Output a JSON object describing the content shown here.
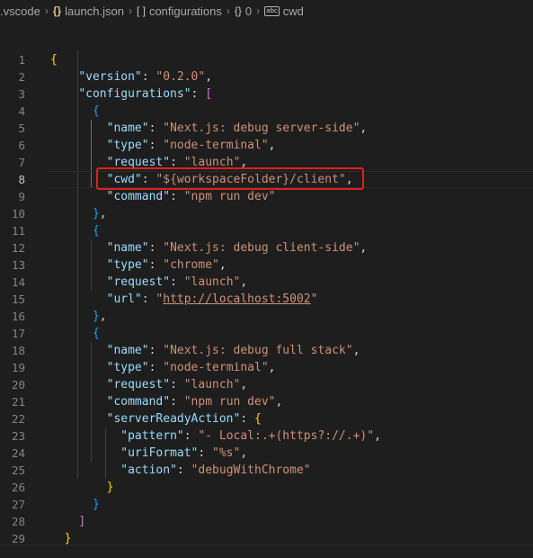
{
  "breadcrumb": {
    "folder": ".vscode",
    "file": "launch.json",
    "array": "configurations",
    "object": "0",
    "property": "cwd"
  },
  "editor": {
    "active_line": 8,
    "lines": [
      {
        "n": "1",
        "tokens": [
          [
            "b1",
            "{"
          ]
        ]
      },
      {
        "n": "2",
        "tokens": [
          [
            "p",
            "    "
          ],
          [
            "k",
            "\"version\""
          ],
          [
            "p",
            ": "
          ],
          [
            "s",
            "\"0.2.0\""
          ],
          [
            "p",
            ","
          ]
        ]
      },
      {
        "n": "3",
        "tokens": [
          [
            "p",
            "    "
          ],
          [
            "k",
            "\"configurations\""
          ],
          [
            "p",
            ": "
          ],
          [
            "b2",
            "["
          ]
        ]
      },
      {
        "n": "4",
        "tokens": [
          [
            "p",
            "      "
          ],
          [
            "b3",
            "{"
          ]
        ]
      },
      {
        "n": "5",
        "tokens": [
          [
            "p",
            "        "
          ],
          [
            "k",
            "\"name\""
          ],
          [
            "p",
            ": "
          ],
          [
            "s",
            "\"Next.js: debug server-side\""
          ],
          [
            "p",
            ","
          ]
        ]
      },
      {
        "n": "6",
        "tokens": [
          [
            "p",
            "        "
          ],
          [
            "k",
            "\"type\""
          ],
          [
            "p",
            ": "
          ],
          [
            "s",
            "\"node-terminal\""
          ],
          [
            "p",
            ","
          ]
        ]
      },
      {
        "n": "7",
        "tokens": [
          [
            "p",
            "        "
          ],
          [
            "k",
            "\"request\""
          ],
          [
            "p",
            ": "
          ],
          [
            "s",
            "\"launch\""
          ],
          [
            "p",
            ","
          ]
        ]
      },
      {
        "n": "8",
        "tokens": [
          [
            "p",
            "        "
          ],
          [
            "k",
            "\"cwd\""
          ],
          [
            "p",
            ": "
          ],
          [
            "s",
            "\"${workspaceFolder}/client\""
          ],
          [
            "p",
            ","
          ]
        ]
      },
      {
        "n": "9",
        "tokens": [
          [
            "p",
            "        "
          ],
          [
            "k",
            "\"command\""
          ],
          [
            "p",
            ": "
          ],
          [
            "s",
            "\"npm run dev\""
          ]
        ]
      },
      {
        "n": "10",
        "tokens": [
          [
            "p",
            "      "
          ],
          [
            "b3",
            "}"
          ],
          [
            "p",
            ","
          ]
        ]
      },
      {
        "n": "11",
        "tokens": [
          [
            "p",
            "      "
          ],
          [
            "b3",
            "{"
          ]
        ]
      },
      {
        "n": "12",
        "tokens": [
          [
            "p",
            "        "
          ],
          [
            "k",
            "\"name\""
          ],
          [
            "p",
            ": "
          ],
          [
            "s",
            "\"Next.js: debug client-side\""
          ],
          [
            "p",
            ","
          ]
        ]
      },
      {
        "n": "13",
        "tokens": [
          [
            "p",
            "        "
          ],
          [
            "k",
            "\"type\""
          ],
          [
            "p",
            ": "
          ],
          [
            "s",
            "\"chrome\""
          ],
          [
            "p",
            ","
          ]
        ]
      },
      {
        "n": "14",
        "tokens": [
          [
            "p",
            "        "
          ],
          [
            "k",
            "\"request\""
          ],
          [
            "p",
            ": "
          ],
          [
            "s",
            "\"launch\""
          ],
          [
            "p",
            ","
          ]
        ]
      },
      {
        "n": "15",
        "tokens": [
          [
            "p",
            "        "
          ],
          [
            "k",
            "\"url\""
          ],
          [
            "p",
            ": "
          ],
          [
            "s",
            "\""
          ],
          [
            "s url",
            "http://localhost:5002"
          ],
          [
            "s",
            "\""
          ]
        ]
      },
      {
        "n": "16",
        "tokens": [
          [
            "p",
            "      "
          ],
          [
            "b3",
            "}"
          ],
          [
            "p",
            ","
          ]
        ]
      },
      {
        "n": "17",
        "tokens": [
          [
            "p",
            "      "
          ],
          [
            "b3",
            "{"
          ]
        ]
      },
      {
        "n": "18",
        "tokens": [
          [
            "p",
            "        "
          ],
          [
            "k",
            "\"name\""
          ],
          [
            "p",
            ": "
          ],
          [
            "s",
            "\"Next.js: debug full stack\""
          ],
          [
            "p",
            ","
          ]
        ]
      },
      {
        "n": "19",
        "tokens": [
          [
            "p",
            "        "
          ],
          [
            "k",
            "\"type\""
          ],
          [
            "p",
            ": "
          ],
          [
            "s",
            "\"node-terminal\""
          ],
          [
            "p",
            ","
          ]
        ]
      },
      {
        "n": "20",
        "tokens": [
          [
            "p",
            "        "
          ],
          [
            "k",
            "\"request\""
          ],
          [
            "p",
            ": "
          ],
          [
            "s",
            "\"launch\""
          ],
          [
            "p",
            ","
          ]
        ]
      },
      {
        "n": "21",
        "tokens": [
          [
            "p",
            "        "
          ],
          [
            "k",
            "\"command\""
          ],
          [
            "p",
            ": "
          ],
          [
            "s",
            "\"npm run dev\""
          ],
          [
            "p",
            ","
          ]
        ]
      },
      {
        "n": "22",
        "tokens": [
          [
            "p",
            "        "
          ],
          [
            "k",
            "\"serverReadyAction\""
          ],
          [
            "p",
            ": "
          ],
          [
            "b1",
            "{"
          ]
        ]
      },
      {
        "n": "23",
        "tokens": [
          [
            "p",
            "          "
          ],
          [
            "k",
            "\"pattern\""
          ],
          [
            "p",
            ": "
          ],
          [
            "s",
            "\"- Local:.+(https?://.+)\""
          ],
          [
            "p",
            ","
          ]
        ]
      },
      {
        "n": "24",
        "tokens": [
          [
            "p",
            "          "
          ],
          [
            "k",
            "\"uriFormat\""
          ],
          [
            "p",
            ": "
          ],
          [
            "s",
            "\"%s\""
          ],
          [
            "p",
            ","
          ]
        ]
      },
      {
        "n": "25",
        "tokens": [
          [
            "p",
            "          "
          ],
          [
            "k",
            "\"action\""
          ],
          [
            "p",
            ": "
          ],
          [
            "s",
            "\"debugWithChrome\""
          ]
        ]
      },
      {
        "n": "26",
        "tokens": [
          [
            "p",
            "        "
          ],
          [
            "b1",
            "}"
          ]
        ]
      },
      {
        "n": "27",
        "tokens": [
          [
            "p",
            "      "
          ],
          [
            "b3",
            "}"
          ]
        ]
      },
      {
        "n": "28",
        "tokens": [
          [
            "p",
            "    "
          ],
          [
            "b2",
            "]"
          ]
        ]
      },
      {
        "n": "29",
        "tokens": [
          [
            "p",
            "  "
          ],
          [
            "b1",
            "}"
          ]
        ]
      }
    ]
  }
}
